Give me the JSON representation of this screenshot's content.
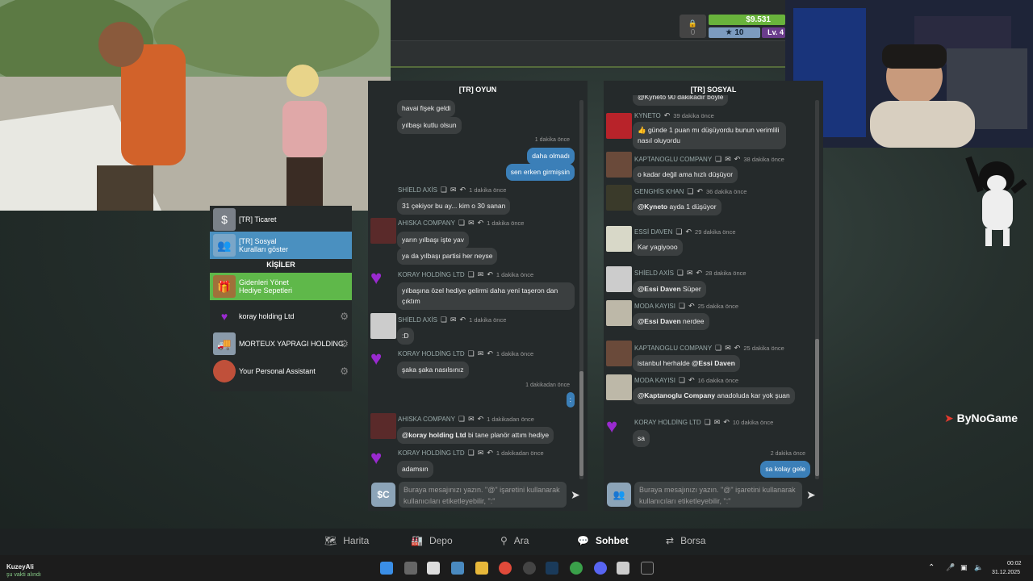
{
  "hud": {
    "money": "$9.531",
    "stars": "10",
    "level": "Lv. 4",
    "lock_count": "0"
  },
  "left_panel": {
    "channels": [
      {
        "label": "[TR] Ticaret"
      },
      {
        "label": "[TR] Sosyal",
        "sublabel": "Kuralları göster"
      }
    ],
    "people_header": "KİŞİLER",
    "people": [
      {
        "label": "Gidenleri Yönet",
        "sublabel": "Hediye Sepetleri"
      },
      {
        "label": "koray holding Ltd"
      },
      {
        "label": "MORTEUX YAPRAGI HOLDING"
      },
      {
        "label": "Your Personal Assistant"
      }
    ]
  },
  "chat_oyun": {
    "title": "[TR] OYUN",
    "messages": [
      {
        "text": "havai fişek geldi"
      },
      {
        "text": "yılbaşı kutlu olsun"
      },
      {
        "time": "1 dakika önce"
      },
      {
        "text": "daha olmadı"
      },
      {
        "text": "sen erken girmişsin"
      },
      {
        "name": "SHİELD AXİS",
        "time": "1 dakika önce",
        "text": "31 çekiyor bu ay... kim o 30 sanan"
      },
      {
        "name": "AHISKA COMPANY",
        "time": "1 dakika önce",
        "text": "yarın yılbaşı işte yav"
      },
      {
        "text": "ya da yılbaşı partisi her neyse"
      },
      {
        "name": "KORAY HOLDİNG LTD",
        "time": "1 dakika önce",
        "text": "yılbaşına özel hediye gelirmi daha yeni taşeron dan çıktım"
      },
      {
        "name": "SHİELD AXİS",
        "time": "1 dakika önce",
        "text": ":D"
      },
      {
        "name": "KORAY HOLDİNG LTD",
        "time": "1 dakika önce",
        "text": "şaka şaka nasılsınız"
      },
      {
        "time": "1 dakikadan önce"
      },
      {
        "text": ":"
      },
      {
        "name": "AHISKA COMPANY",
        "time": "1 dakikadan önce",
        "mention": "@koray holding Ltd",
        "text": " bi tane planör attım hediye"
      },
      {
        "name": "KORAY HOLDİNG LTD",
        "time": "1 dakikadan önce",
        "text": "adamsın"
      }
    ],
    "input_placeholder": "Buraya mesajınızı yazın. \"@\" işaretini kullanarak kullanıcıları etiketleyebilir, \":\""
  },
  "chat_sosyal": {
    "title": "[TR] SOSYAL",
    "messages": [
      {
        "text": "@Kyneto 90 dakikadır böyle"
      },
      {
        "name": "KYNETO",
        "time": "39 dakika önce",
        "text": "👍 günde 1 puan mı düşüyordu bunun verimlili nasıl oluyordu"
      },
      {
        "name": "KAPTANOGLU COMPANY",
        "time": "38 dakika önce",
        "text": "o kadar değil ama hızlı düşüyor"
      },
      {
        "name": "GENGHİS KHAN",
        "time": "36 dakika önce",
        "mention": "@Kyneto",
        "text": " ayda 1 düşüyor"
      },
      {
        "name": "ESSİ DAVEN",
        "time": "29 dakika önce",
        "text": "Kar yagiyooo"
      },
      {
        "name": "SHİELD AXİS",
        "time": "28 dakika önce",
        "mention": "@Essi Daven",
        "text": " Süper"
      },
      {
        "name": "MODA KAYISI",
        "time": "25 dakika önce",
        "mention": "@Essi Daven",
        "text": " nerdee"
      },
      {
        "name": "KAPTANOGLU COMPANY",
        "time": "25 dakika önce",
        "text": "istanbul herhalde ",
        "mention_after": "@Essi Daven"
      },
      {
        "name": "MODA KAYISI",
        "time": "16 dakika önce",
        "mention": "@Kaptanoglu Company",
        "text": " anadoluda kar yok şuan"
      },
      {
        "name": "KORAY HOLDİNG LTD",
        "time": "10 dakika önce",
        "text": "sa"
      },
      {
        "time": "2 dakika önce"
      },
      {
        "text": "sa kolay gele"
      }
    ],
    "input_placeholder": "Buraya mesajınızı yazın. \"@\" işaretini kullanarak kullanıcıları etiketleyebilir, \":\""
  },
  "nav": {
    "items": [
      "Harita",
      "Depo",
      "Ara",
      "Sohbet",
      "Borsa"
    ],
    "active": "Sohbet"
  },
  "brand": "ByNoGame",
  "taskbar": {
    "user_name": "KuzeyAli",
    "user_status": "şu vakti alındı",
    "time": "00:02",
    "date": "31.12.2025"
  },
  "colors": {
    "own_bubble": "#3b7fb8",
    "money_bar": "#69b33c",
    "active_channel": "#4a90c0",
    "people_highlight": "#5fb84a"
  }
}
